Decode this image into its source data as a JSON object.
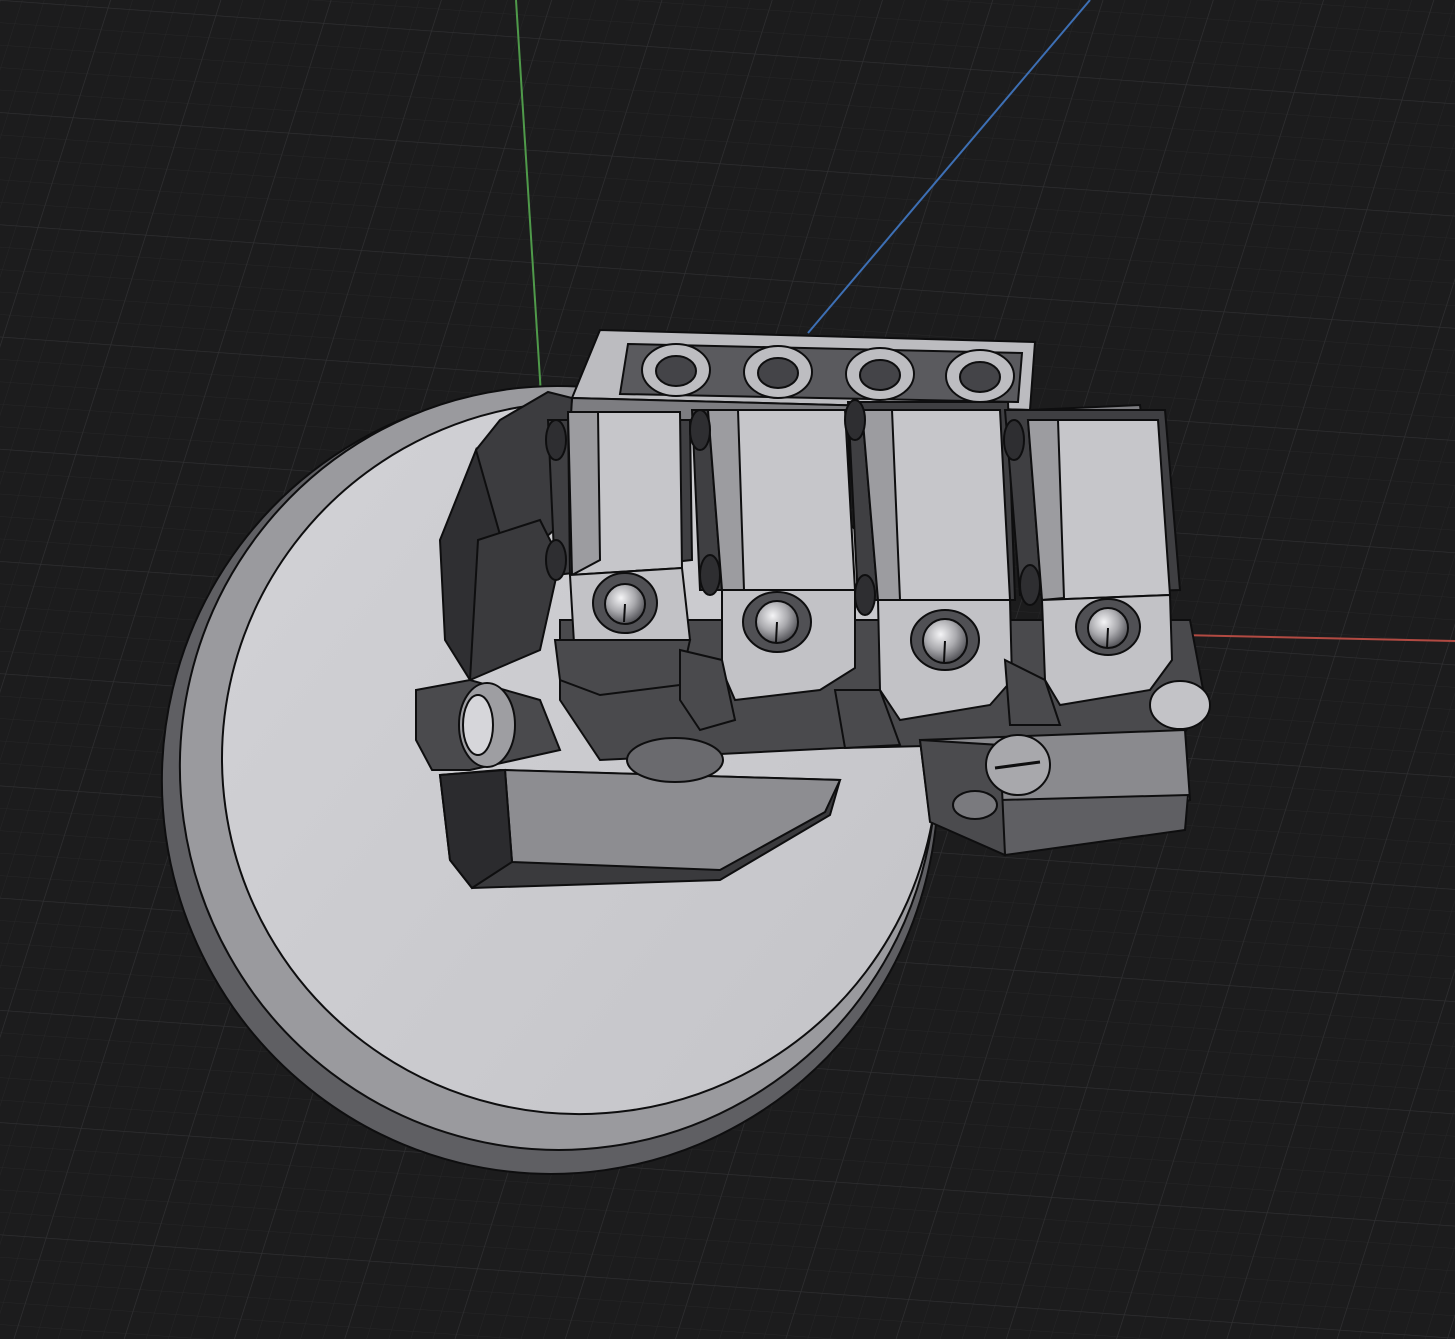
{
  "viewport": {
    "background": "#1c1c1d",
    "grid_minor_color": "#262627",
    "grid_major_color": "#303032"
  },
  "axes": {
    "x_color": "#b24a42",
    "y_color": "#4f9a4a",
    "z_color": "#3d6fb4"
  },
  "model": {
    "fill_light": "#c9c9cd",
    "fill_mid": "#9c9ca0",
    "fill_dark": "#4a4a4d",
    "edge_color": "#0e0e0f",
    "finger_count": 4
  }
}
